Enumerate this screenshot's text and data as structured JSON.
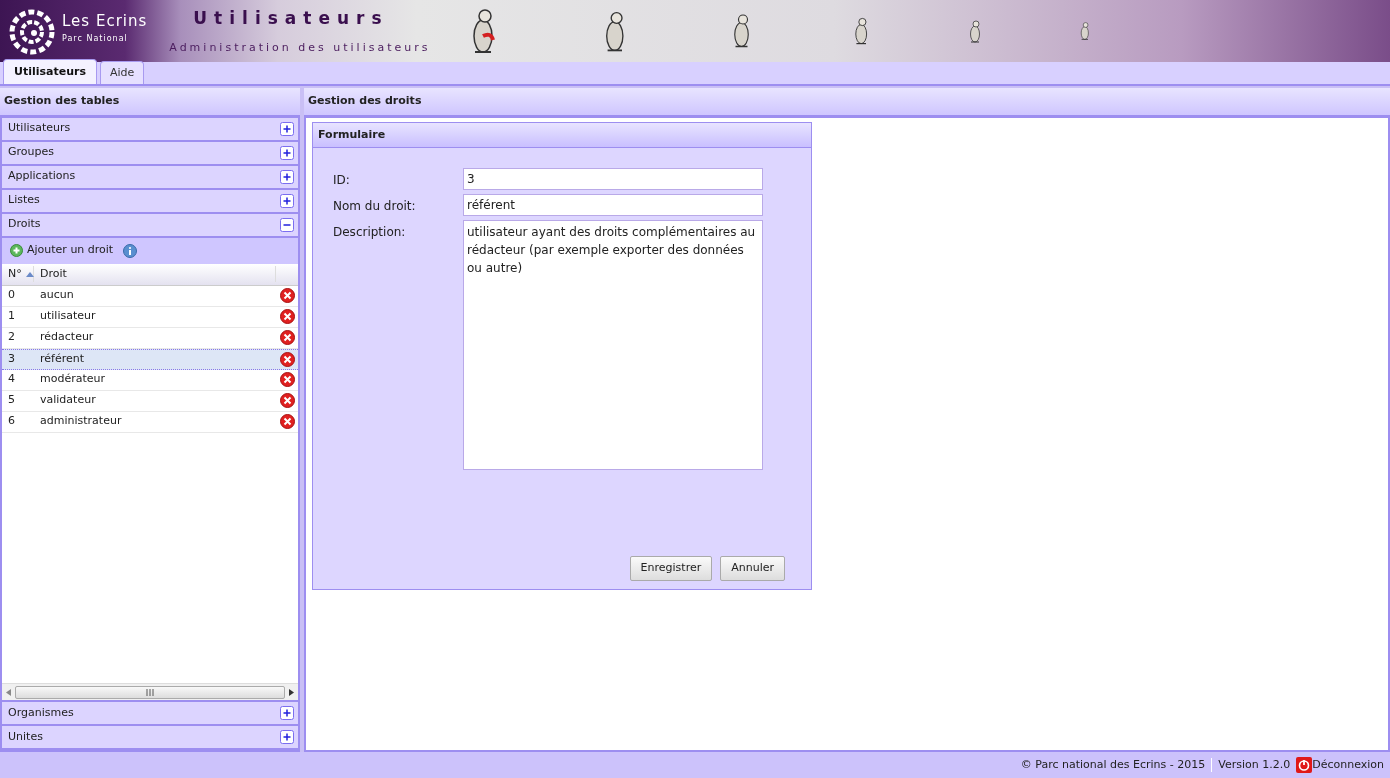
{
  "header": {
    "logo_text": "Les Ecrins",
    "logo_subtext": "Parc National",
    "title": "Utilisateurs",
    "subtitle": "Administration des utilisateurs"
  },
  "tabs": [
    {
      "label": "Utilisateurs",
      "selected": true
    },
    {
      "label": "Aide",
      "selected": false
    }
  ],
  "left_panel": {
    "title": "Gestion des tables",
    "sections": [
      {
        "label": "Utilisateurs",
        "expanded": false
      },
      {
        "label": "Groupes",
        "expanded": false
      },
      {
        "label": "Applications",
        "expanded": false
      },
      {
        "label": "Listes",
        "expanded": false
      },
      {
        "label": "Droits",
        "expanded": true
      },
      {
        "label": "Organismes",
        "expanded": false
      },
      {
        "label": "Unites",
        "expanded": false
      }
    ],
    "toolbar": {
      "add_label": "Ajouter un droit"
    },
    "table": {
      "columns": [
        "N°",
        "Droit"
      ],
      "rows": [
        {
          "id": "0",
          "name": "aucun",
          "selected": false
        },
        {
          "id": "1",
          "name": "utilisateur",
          "selected": false
        },
        {
          "id": "2",
          "name": "rédacteur",
          "selected": false
        },
        {
          "id": "3",
          "name": "référent",
          "selected": true
        },
        {
          "id": "4",
          "name": "modérateur",
          "selected": false
        },
        {
          "id": "5",
          "name": "validateur",
          "selected": false
        },
        {
          "id": "6",
          "name": "administrateur",
          "selected": false
        }
      ]
    }
  },
  "right_panel": {
    "title": "Gestion des droits",
    "form": {
      "title": "Formulaire",
      "fields": [
        {
          "kind": "input",
          "label": "ID:",
          "value": "3"
        },
        {
          "kind": "input",
          "label": "Nom du droit:",
          "value": "référent"
        },
        {
          "kind": "textarea",
          "label": "Description:",
          "value": "utilisateur ayant des droits complémentaires au rédacteur (par exemple exporter des données ou autre)"
        }
      ],
      "buttons": [
        "Enregistrer",
        "Annuler"
      ]
    }
  },
  "footer": {
    "copyright": "© Parc national des Ecrins - 2015",
    "version": "Version 1.2.0",
    "logout": "Déconnexion"
  }
}
